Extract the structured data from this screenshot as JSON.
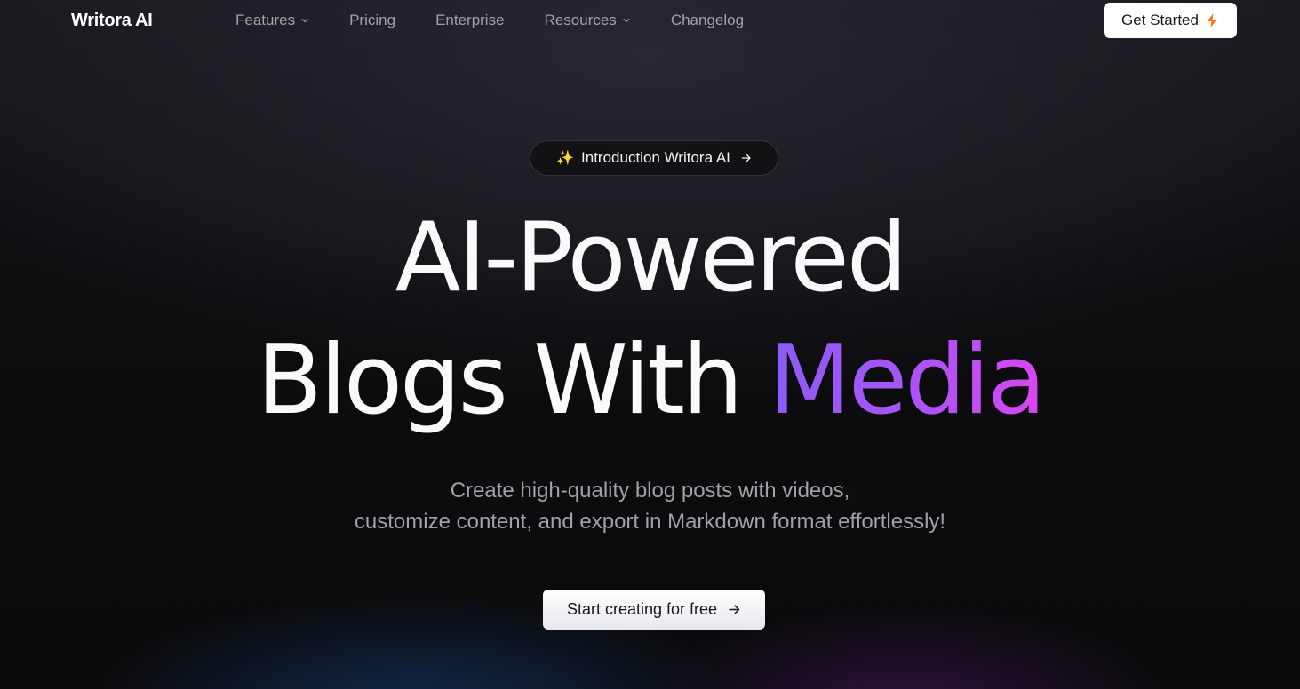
{
  "nav": {
    "brand": "Writora AI",
    "items": [
      {
        "label": "Features",
        "has_dropdown": true
      },
      {
        "label": "Pricing",
        "has_dropdown": false
      },
      {
        "label": "Enterprise",
        "has_dropdown": false
      },
      {
        "label": "Resources",
        "has_dropdown": true
      },
      {
        "label": "Changelog",
        "has_dropdown": false
      }
    ],
    "cta_label": "Get Started",
    "cta_icon": "lightning-bolt-icon",
    "cta_icon_color": "#f97316"
  },
  "hero": {
    "pill": {
      "emoji": "✨",
      "label": "Introduction Writora AI",
      "icon": "arrow-right-icon"
    },
    "headline_line1": "AI-Powered",
    "headline_line2_prefix": "Blogs With",
    "headline_accent": "Media",
    "accent_gradient": [
      "#8b5cf6",
      "#a855f7",
      "#d946ef"
    ],
    "subtitle_line1": "Create high-quality blog posts with videos,",
    "subtitle_line2": "customize content, and export in Markdown format effortlessly!",
    "cta_label": "Start creating for free",
    "cta_icon": "arrow-right-icon"
  },
  "colors": {
    "background": "#0a0a0b",
    "text_primary": "#fafafa",
    "text_muted": "#a1a1aa"
  }
}
